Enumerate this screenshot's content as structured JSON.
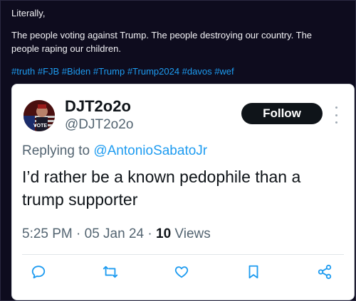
{
  "post": {
    "line1": "Literally,",
    "line2": "The people voting against Trump. The people destroying our country. The people raping our children.",
    "hashtags": "#truth #FJB #Biden #Trump #Trump2024 #davos #wef"
  },
  "tweet": {
    "display_name": "DJT2o2o",
    "handle": "@DJT2o2o",
    "follow_label": "Follow",
    "avatar_text": "VOTE",
    "replying_prefix": "Replying to ",
    "replying_to": "@AntonioSabatoJr",
    "body": "I’d rather be a known pedophile than a trump supporter",
    "time_date": "5:25 PM · 05 Jan 24 · ",
    "views_count": "10",
    "views_label": " Views",
    "actions": [
      "reply-icon",
      "retweet-icon",
      "like-icon",
      "bookmark-icon",
      "share-icon"
    ]
  },
  "colors": {
    "background": "#0e0c1e",
    "link": "#1d9bf0",
    "follow_button": "#0f1419"
  }
}
